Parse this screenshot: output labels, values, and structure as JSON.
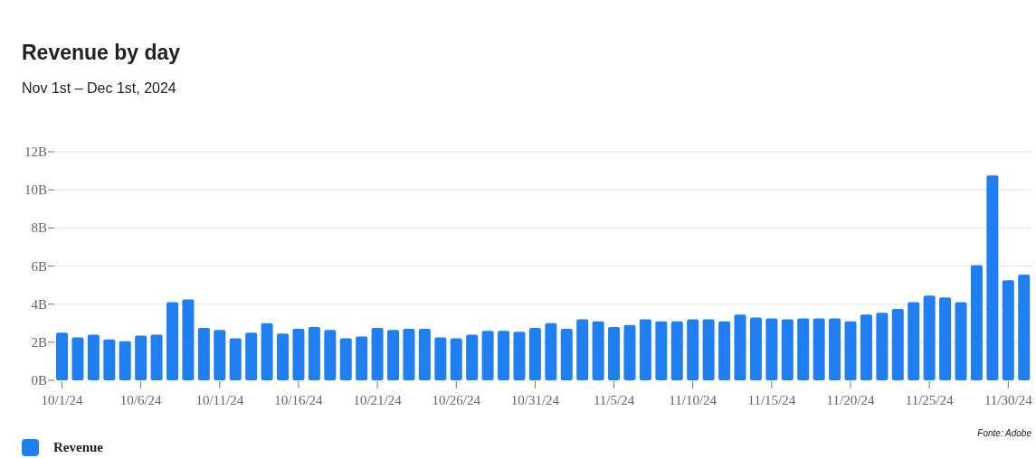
{
  "chart": {
    "subtitle": "Nov 1st – Dec 1st, 2024",
    "chart_data": {
      "type": "bar",
      "title": "Revenue by day",
      "categories": [
        "10/1/24",
        null,
        null,
        null,
        null,
        "10/6/24",
        null,
        null,
        null,
        null,
        "10/11/24",
        null,
        null,
        null,
        null,
        "10/16/24",
        null,
        null,
        null,
        null,
        "10/21/24",
        null,
        null,
        null,
        null,
        "10/26/24",
        null,
        null,
        null,
        null,
        "10/31/24",
        null,
        null,
        null,
        null,
        "11/5/24",
        null,
        null,
        null,
        null,
        "11/10/24",
        null,
        null,
        null,
        null,
        "11/15/24",
        null,
        null,
        null,
        null,
        "11/20/24",
        null,
        null,
        null,
        null,
        "11/25/24",
        null,
        null,
        null,
        null,
        "11/30/24",
        null
      ],
      "grid": true,
      "series": [
        {
          "name": "Revenue",
          "color": "#1f7ff0",
          "values": [
            2.5,
            2.25,
            2.4,
            2.15,
            2.05,
            2.35,
            2.4,
            4.1,
            4.25,
            2.75,
            2.65,
            2.2,
            2.5,
            3.0,
            2.45,
            2.7,
            2.8,
            2.65,
            2.2,
            2.3,
            2.75,
            2.65,
            2.7,
            2.7,
            2.25,
            2.2,
            2.4,
            2.6,
            2.6,
            2.55,
            2.75,
            3.0,
            2.7,
            3.2,
            3.1,
            2.8,
            2.9,
            3.2,
            3.1,
            3.1,
            3.2,
            3.2,
            3.1,
            3.45,
            3.3,
            3.25,
            3.2,
            3.25,
            3.25,
            3.25,
            3.1,
            3.45,
            3.55,
            3.75,
            4.1,
            4.45,
            4.35,
            4.1,
            6.05,
            10.75,
            5.25,
            5.55
          ]
        }
      ],
      "ylim": [
        0,
        12
      ],
      "yticks": [
        {
          "value": 0,
          "label": "0B"
        },
        {
          "value": 2,
          "label": "2B"
        },
        {
          "value": 4,
          "label": "4B"
        },
        {
          "value": 6,
          "label": "6B"
        },
        {
          "value": 8,
          "label": "8B"
        },
        {
          "value": 10,
          "label": "10B"
        },
        {
          "value": 12,
          "label": "12B"
        }
      ]
    },
    "source": "Fonte: Adobe"
  }
}
